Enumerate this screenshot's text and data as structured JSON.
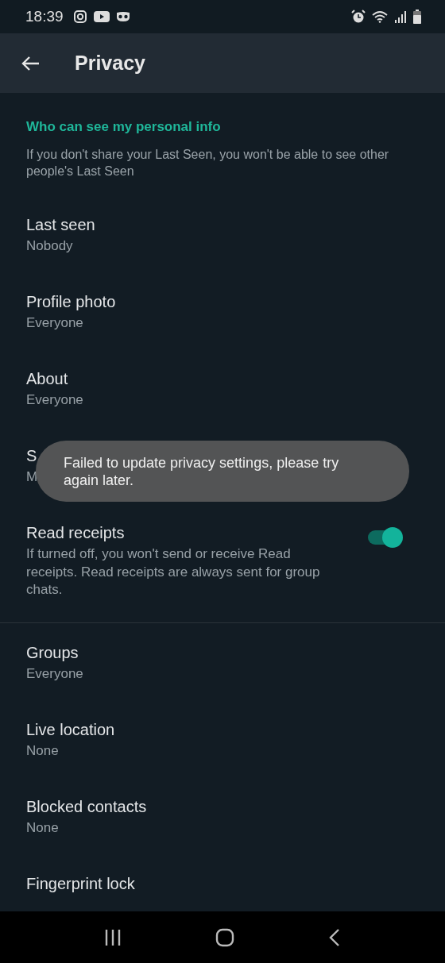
{
  "status_bar": {
    "time": "18:39"
  },
  "app_bar": {
    "title": "Privacy"
  },
  "section": {
    "header": "Who can see my personal info",
    "description": "If you don't share your Last Seen, you won't be able to see other people's Last Seen"
  },
  "settings": [
    {
      "kind": "choice",
      "title": "Last seen",
      "value": "Nobody"
    },
    {
      "kind": "choice",
      "title": "Profile photo",
      "value": "Everyone"
    },
    {
      "kind": "choice",
      "title": "About",
      "value": "Everyone"
    },
    {
      "kind": "choice",
      "title": "S",
      "value": "M"
    },
    {
      "kind": "toggle",
      "title": "Read receipts",
      "description": "If turned off, you won't send or receive Read receipts. Read receipts are always sent for group chats.",
      "on": true
    },
    {
      "kind": "divider"
    },
    {
      "kind": "choice",
      "title": "Groups",
      "value": "Everyone"
    },
    {
      "kind": "choice",
      "title": "Live location",
      "value": "None"
    },
    {
      "kind": "choice",
      "title": "Blocked contacts",
      "value": "None"
    },
    {
      "kind": "choice",
      "title": "Fingerprint lock"
    }
  ],
  "toast": {
    "message": "Failed to update privacy settings, please try again later."
  }
}
